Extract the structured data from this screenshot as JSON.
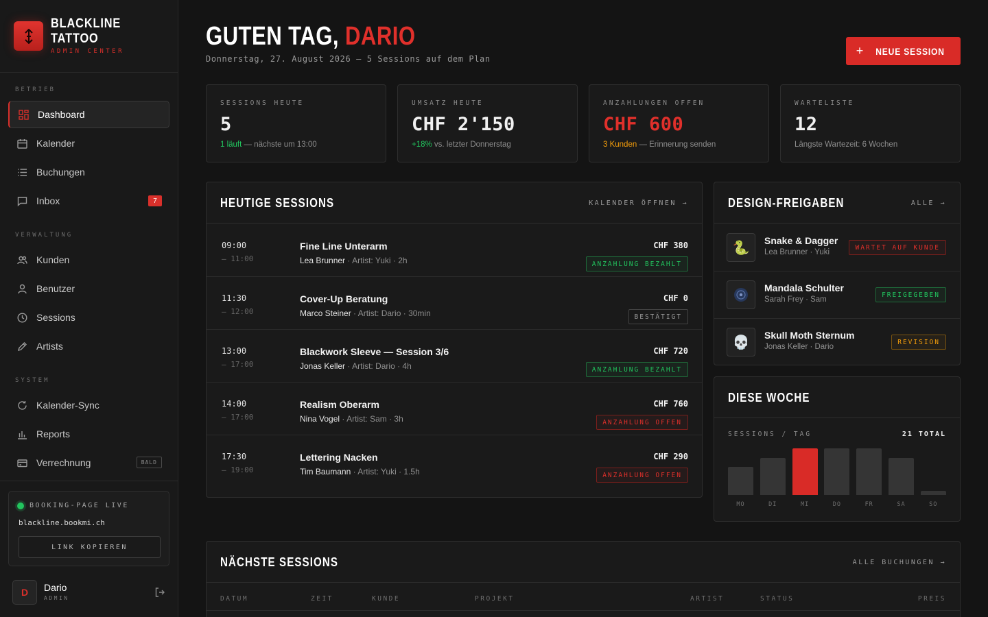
{
  "brand": {
    "name_line1": "BLACKLINE",
    "name_line2": "TATTOO",
    "sub": "ADMIN CENTER"
  },
  "colors": {
    "accent": "#d92b27",
    "success": "#22c55e",
    "warning": "#f59e0b",
    "background": "#141414"
  },
  "nav": {
    "sections": [
      {
        "label": "BETRIEB",
        "items": [
          {
            "label": "Dashboard",
            "icon": "grid-icon",
            "active": true
          },
          {
            "label": "Kalender",
            "icon": "calendar-icon"
          },
          {
            "label": "Buchungen",
            "icon": "list-icon"
          },
          {
            "label": "Inbox",
            "icon": "message-icon",
            "badge": "7"
          }
        ]
      },
      {
        "label": "VERWALTUNG",
        "items": [
          {
            "label": "Kunden",
            "icon": "users-icon"
          },
          {
            "label": "Benutzer",
            "icon": "user-icon"
          },
          {
            "label": "Sessions",
            "icon": "clock-icon"
          },
          {
            "label": "Artists",
            "icon": "pen-icon"
          }
        ]
      },
      {
        "label": "SYSTEM",
        "items": [
          {
            "label": "Kalender-Sync",
            "icon": "refresh-icon"
          },
          {
            "label": "Reports",
            "icon": "bar-chart-icon"
          },
          {
            "label": "Verrechnung",
            "icon": "card-icon",
            "soon": "BALD"
          }
        ]
      }
    ]
  },
  "booking": {
    "label": "BOOKING-PAGE LIVE",
    "url": "blackline.bookmi.ch",
    "button": "LINK KOPIEREN"
  },
  "user": {
    "initial": "D",
    "name": "Dario",
    "role": "ADMIN"
  },
  "header": {
    "greeting": "GUTEN TAG,",
    "name": "DARIO",
    "subline": "Donnerstag, 27. August 2026 — 5 Sessions auf dem Plan",
    "cta": "NEUE SESSION"
  },
  "kpis": [
    {
      "label": "SESSIONS HEUTE",
      "value": "5",
      "note_highlight": "1 läuft",
      "note_rest": " — nächste um 13:00"
    },
    {
      "label": "UMSATZ HEUTE",
      "value": "CHF 2'150",
      "note_highlight": "+18%",
      "note_rest": " vs. letzter Donnerstag"
    },
    {
      "label": "ANZAHLUNGEN OFFEN",
      "value": "CHF 600",
      "note_highlight": "3 Kunden",
      "note_rest": " — Erinnerung senden"
    },
    {
      "label": "WARTELISTE",
      "value": "12",
      "note_highlight": "",
      "note_rest": "Längste Wartezeit: 6 Wochen"
    }
  ],
  "today": {
    "title": "HEUTIGE SESSIONS",
    "link": "KALENDER ÖFFNEN →",
    "rows": [
      {
        "start": "09:00",
        "end": "– 11:00",
        "title": "Fine Line Unterarm",
        "client": "Lea Brunner",
        "artist": "Artist: Yuki",
        "duration": "2h",
        "price": "CHF 380",
        "status": "ANZAHLUNG BEZAHLT",
        "tone": "green"
      },
      {
        "start": "11:30",
        "end": "– 12:00",
        "title": "Cover-Up Beratung",
        "client": "Marco Steiner",
        "artist": "Artist: Dario",
        "duration": "30min",
        "price": "CHF 0",
        "status": "BESTÄTIGT",
        "tone": "gray"
      },
      {
        "start": "13:00",
        "end": "– 17:00",
        "title": "Blackwork Sleeve — Session 3/6",
        "client": "Jonas Keller",
        "artist": "Artist: Dario",
        "duration": "4h",
        "price": "CHF 720",
        "status": "ANZAHLUNG BEZAHLT",
        "tone": "green"
      },
      {
        "start": "14:00",
        "end": "– 17:00",
        "title": "Realism Oberarm",
        "client": "Nina Vogel",
        "artist": "Artist: Sam",
        "duration": "3h",
        "price": "CHF 760",
        "status": "ANZAHLUNG OFFEN",
        "tone": "red"
      },
      {
        "start": "17:30",
        "end": "– 19:00",
        "title": "Lettering Nacken",
        "client": "Tim Baumann",
        "artist": "Artist: Yuki",
        "duration": "1.5h",
        "price": "CHF 290",
        "status": "ANZAHLUNG OFFEN",
        "tone": "red"
      }
    ]
  },
  "designs": {
    "title": "DESIGN-FREIGABEN",
    "link": "ALLE →",
    "rows": [
      {
        "icon": "🐍",
        "icon_name": "snake-icon",
        "title": "Snake & Dagger",
        "meta": "Lea Brunner · Yuki",
        "status": "WARTET AUF KUNDE",
        "tone": "red"
      },
      {
        "icon": "",
        "icon_name": "mandala-icon",
        "title": "Mandala Schulter",
        "meta": "Sarah Frey · Sam",
        "status": "FREIGEGEBEN",
        "tone": "green"
      },
      {
        "icon": "💀",
        "icon_name": "skull-icon",
        "title": "Skull Moth Sternum",
        "meta": "Jonas Keller · Dario",
        "status": "REVISION",
        "tone": "amber"
      }
    ]
  },
  "week": {
    "title": "DIESE WOCHE",
    "label": "SESSIONS / TAG",
    "total": "21 TOTAL"
  },
  "chart_data": {
    "type": "bar",
    "categories": [
      "MO",
      "DI",
      "MI",
      "DO",
      "FR",
      "SA",
      "SO"
    ],
    "values": [
      3,
      4,
      5,
      5,
      5,
      4,
      0
    ],
    "highlight": "MI"
  },
  "upcoming": {
    "title": "NÄCHSTE SESSIONS",
    "link": "ALLE BUCHUNGEN →",
    "columns": [
      "DATUM",
      "ZEIT",
      "KUNDE",
      "PROJEKT",
      "ARTIST",
      "STATUS",
      "PREIS"
    ]
  }
}
